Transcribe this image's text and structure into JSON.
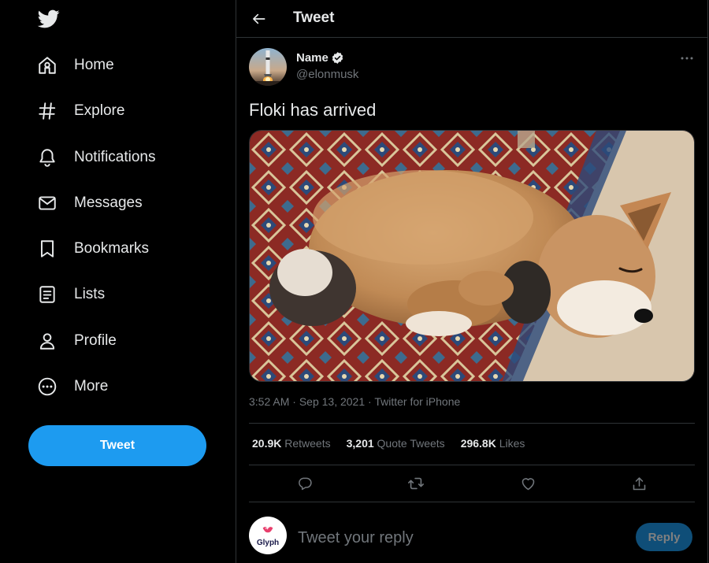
{
  "sidebar": {
    "logo_icon": "twitter-bird-icon",
    "items": [
      {
        "label": "Home",
        "icon": "home-icon"
      },
      {
        "label": "Explore",
        "icon": "hashtag-icon"
      },
      {
        "label": "Notifications",
        "icon": "bell-icon"
      },
      {
        "label": "Messages",
        "icon": "mail-icon"
      },
      {
        "label": "Bookmarks",
        "icon": "bookmark-icon"
      },
      {
        "label": "Lists",
        "icon": "list-icon"
      },
      {
        "label": "Profile",
        "icon": "person-icon"
      },
      {
        "label": "More",
        "icon": "more-circle-icon"
      }
    ],
    "tweet_button": "Tweet"
  },
  "header": {
    "title": "Tweet"
  },
  "tweet": {
    "author_name": "Name",
    "author_handle": "@elonmusk",
    "text": "Floki has arrived",
    "time": "3:52 AM",
    "date": "Sep 13, 2021",
    "source": "Twitter for iPhone",
    "stats": {
      "retweets_count": "20.9K",
      "retweets_label": "Retweets",
      "quotes_count": "3,201",
      "quotes_label": "Quote Tweets",
      "likes_count": "296.8K",
      "likes_label": "Likes"
    }
  },
  "reply": {
    "avatar_text": "Glyph",
    "placeholder": "Tweet your reply",
    "button": "Reply"
  },
  "colors": {
    "accent": "#1d9bf0",
    "background": "#000000",
    "border": "#2f3336",
    "secondary_text": "#71767b"
  }
}
